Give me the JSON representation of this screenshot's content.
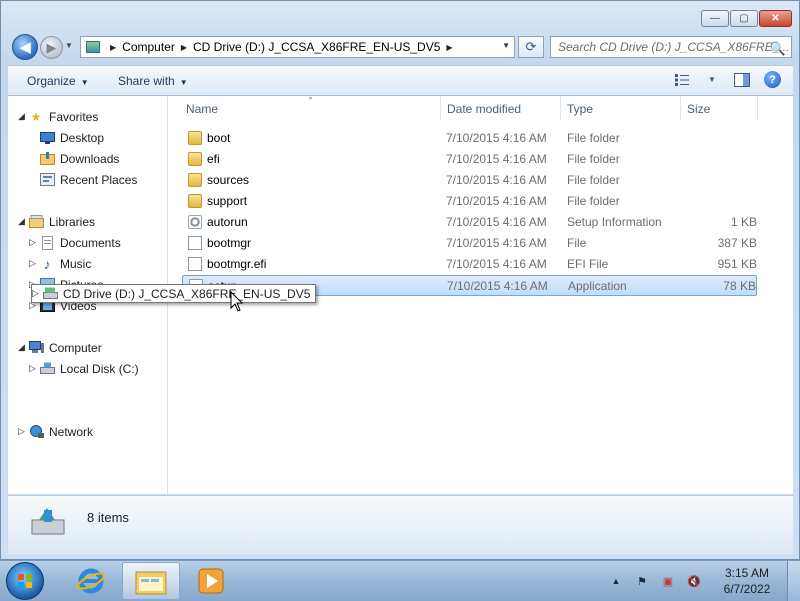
{
  "window": {
    "buttons": {
      "minimize": "—",
      "maximize": "▢",
      "close": "✕"
    }
  },
  "address": {
    "crumbs": [
      "Computer",
      "CD Drive (D:) J_CCSA_X86FRE_EN-US_DV5"
    ],
    "separator": "▶",
    "dropdown_glyph": "▼",
    "refresh_glyph": "⟳"
  },
  "search": {
    "placeholder": "Search CD Drive (D:) J_CCSA_X86FRE_...",
    "icon": "🔍"
  },
  "toolbar": {
    "organize_label": "Organize",
    "share_label": "Share with",
    "dropdown_glyph": "▼",
    "help_glyph": "?"
  },
  "navpane": {
    "favorites": {
      "label": "Favorites",
      "items": [
        "Desktop",
        "Downloads",
        "Recent Places"
      ]
    },
    "libraries": {
      "label": "Libraries",
      "items": [
        "Documents",
        "Music",
        "Pictures",
        "Videos"
      ]
    },
    "computer": {
      "label": "Computer",
      "items": [
        "Local Disk (C:)",
        "CD Drive (D:) J_CCSA_X86FRE_EN-US_DV5"
      ]
    },
    "network": {
      "label": "Network"
    },
    "expanded_glyph": "◢",
    "collapsed_glyph": "▷"
  },
  "columns": {
    "name": "Name",
    "date": "Date modified",
    "type": "Type",
    "size": "Size",
    "sort_glyph": "⌃"
  },
  "files": [
    {
      "name": "boot",
      "date": "7/10/2015 4:16 AM",
      "type": "File folder",
      "size": "",
      "icon": "folder"
    },
    {
      "name": "efi",
      "date": "7/10/2015 4:16 AM",
      "type": "File folder",
      "size": "",
      "icon": "folder"
    },
    {
      "name": "sources",
      "date": "7/10/2015 4:16 AM",
      "type": "File folder",
      "size": "",
      "icon": "folder"
    },
    {
      "name": "support",
      "date": "7/10/2015 4:16 AM",
      "type": "File folder",
      "size": "",
      "icon": "folder"
    },
    {
      "name": "autorun",
      "date": "7/10/2015 4:16 AM",
      "type": "Setup Information",
      "size": "1 KB",
      "icon": "gear"
    },
    {
      "name": "bootmgr",
      "date": "7/10/2015 4:16 AM",
      "type": "File",
      "size": "387 KB",
      "icon": "doc"
    },
    {
      "name": "bootmgr.efi",
      "date": "7/10/2015 4:16 AM",
      "type": "EFI File",
      "size": "951 KB",
      "icon": "doc"
    },
    {
      "name": "setup",
      "date": "7/10/2015 4:16 AM",
      "type": "Application",
      "size": "78 KB",
      "icon": "doc",
      "selected": true
    }
  ],
  "details": {
    "count_text": "8 items"
  },
  "taskbar": {
    "clock_time": "3:15 AM",
    "clock_date": "6/7/2022",
    "tray_glyphs": {
      "chevron": "▲",
      "flag": "⚑",
      "network": "▣",
      "volume": "🔇"
    }
  }
}
